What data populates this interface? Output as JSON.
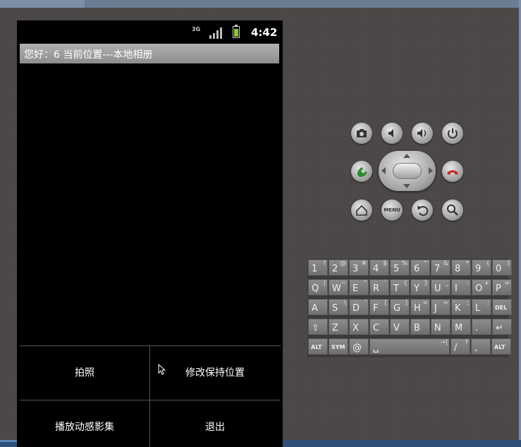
{
  "status_bar": {
    "network": "3G",
    "time": "4:42"
  },
  "app": {
    "title": "您好：6  当前位置---本地相册"
  },
  "menu": {
    "items": [
      {
        "label": "拍照"
      },
      {
        "label": "修改保持位置"
      },
      {
        "label": "播放动感影集"
      },
      {
        "label": "退出"
      }
    ]
  },
  "emulator_controls": {
    "top_row": [
      "camera-icon",
      "volume-down-icon",
      "volume-up-icon",
      "power-icon"
    ],
    "middle": [
      "call-icon",
      "dpad",
      "end-call-icon"
    ],
    "bottom_row": [
      "home-icon",
      "MENU",
      "back-icon",
      "search-icon"
    ]
  },
  "keyboard": {
    "rows": [
      [
        {
          "k": "1",
          "a": "!"
        },
        {
          "k": "2",
          "a": "@"
        },
        {
          "k": "3",
          "a": "#"
        },
        {
          "k": "4",
          "a": "$"
        },
        {
          "k": "5",
          "a": "%"
        },
        {
          "k": "6",
          "a": "^"
        },
        {
          "k": "7",
          "a": "&"
        },
        {
          "k": "8",
          "a": "*"
        },
        {
          "k": "9",
          "a": "("
        },
        {
          "k": "0",
          "a": ")"
        }
      ],
      [
        {
          "k": "Q",
          "a": "|"
        },
        {
          "k": "W",
          "a": "~"
        },
        {
          "k": "E",
          "a": "\""
        },
        {
          "k": "R",
          "a": "`"
        },
        {
          "k": "T",
          "a": "{"
        },
        {
          "k": "Y",
          "a": "}"
        },
        {
          "k": "U",
          "a": "_"
        },
        {
          "k": "I",
          "a": "-"
        },
        {
          "k": "O",
          "a": "+"
        },
        {
          "k": "P",
          "a": "="
        }
      ],
      [
        {
          "k": "A",
          "a": ""
        },
        {
          "k": "S",
          "a": "\\"
        },
        {
          "k": "D",
          "a": "'"
        },
        {
          "k": "F",
          "a": "["
        },
        {
          "k": "G",
          "a": "]"
        },
        {
          "k": "H",
          "a": "<"
        },
        {
          "k": "J",
          "a": ">"
        },
        {
          "k": "K",
          "a": ";"
        },
        {
          "k": "L",
          "a": ":"
        },
        {
          "k": "DEL",
          "a": ""
        }
      ],
      [
        {
          "k": "⇧",
          "a": ""
        },
        {
          "k": "Z",
          "a": ""
        },
        {
          "k": "X",
          "a": ""
        },
        {
          "k": "C",
          "a": ""
        },
        {
          "k": "V",
          "a": ""
        },
        {
          "k": "B",
          "a": ""
        },
        {
          "k": "N",
          "a": ""
        },
        {
          "k": "M",
          "a": ""
        },
        {
          "k": ".",
          "a": ""
        },
        {
          "k": "↵",
          "a": ""
        }
      ],
      [
        {
          "k": "ALT",
          "a": ""
        },
        {
          "k": "SYM",
          "a": ""
        },
        {
          "k": "@",
          "a": ""
        },
        {
          "k": "␣",
          "a": "→|"
        },
        {
          "k": "/",
          "a": "?"
        },
        {
          "k": ",",
          "a": ""
        },
        {
          "k": "ALT",
          "a": ""
        }
      ]
    ]
  },
  "colors": {
    "skin": "#4b4847",
    "screen": "#000000",
    "title_bar": "#9e9e9e",
    "battery": "#8bc53f"
  }
}
